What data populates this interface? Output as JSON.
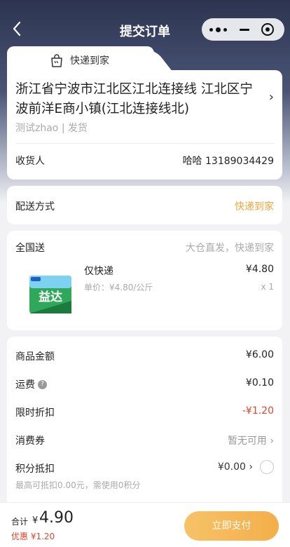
{
  "nav": {
    "title": "提交订单",
    "back_icon": "chevron-left-icon"
  },
  "delivery_tab": {
    "label": "快递到家",
    "icon": "bag-icon"
  },
  "address": {
    "text": "浙江省宁波市江北区江北连接线 江北区宁波前洋E商小镇(江北连接线北)",
    "sub": "测试zhao | 发货",
    "arrow": "›",
    "recipient_label": "收货人",
    "recipient_value": "哈哈 13189034429"
  },
  "shipping": {
    "label": "配送方式",
    "value": "快递到家",
    "accent_color": "#f0a63a"
  },
  "goods": {
    "header": "全国送",
    "tip": "大仓直发，快递到家",
    "item": {
      "name": "仅快递",
      "unit_price": "单价：¥4.80/公斤",
      "price": "¥4.80",
      "qty": "x 1",
      "image_text": "益达"
    }
  },
  "summary": {
    "goods_amount_label": "商品金额",
    "goods_amount_value": "¥6.00",
    "freight_label": "运费",
    "freight_value": "¥0.10",
    "flash_label": "限时折扣",
    "flash_value": "-¥1.20",
    "coupon_label": "消费券",
    "coupon_value": "暂无可用 ›",
    "points_label": "积分抵扣",
    "points_value": "¥0.00 ›",
    "points_note": "最高可抵扣0.00元，需使用0积分"
  },
  "footer": {
    "total_label": "合计",
    "currency": "¥",
    "total_value": "4.90",
    "discount": "优惠 ¥1.20",
    "pay_label": "立即支付"
  },
  "colors": {
    "accent": "#f4ae4a",
    "red": "#e5432d"
  }
}
